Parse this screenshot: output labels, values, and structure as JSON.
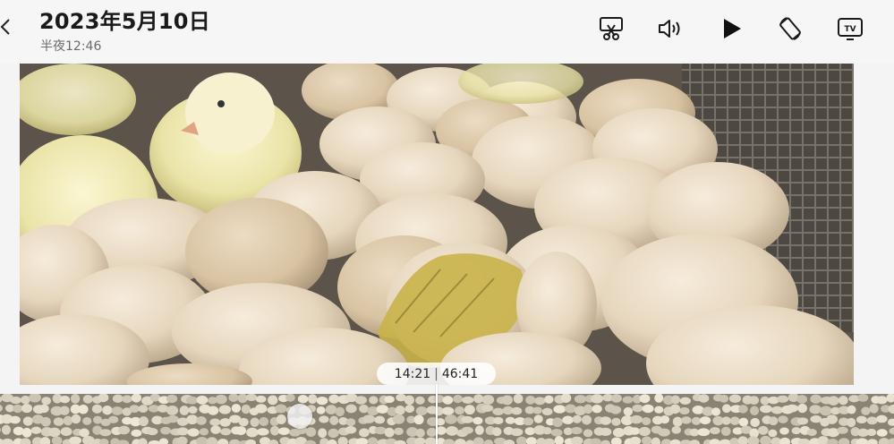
{
  "header": {
    "title": "2023年5月10日",
    "subtitle": "半夜12:46"
  },
  "toolbar": [
    {
      "name": "trim-icon"
    },
    {
      "name": "volume-icon"
    },
    {
      "name": "play-icon"
    },
    {
      "name": "rotate-icon"
    },
    {
      "name": "tv-cast-icon"
    }
  ],
  "player": {
    "current_time": "14:21",
    "total_time": "46:41"
  },
  "colors": {
    "background": "#f4f4f4",
    "icon": "#1a1a1a",
    "pill": "#ffffff"
  }
}
